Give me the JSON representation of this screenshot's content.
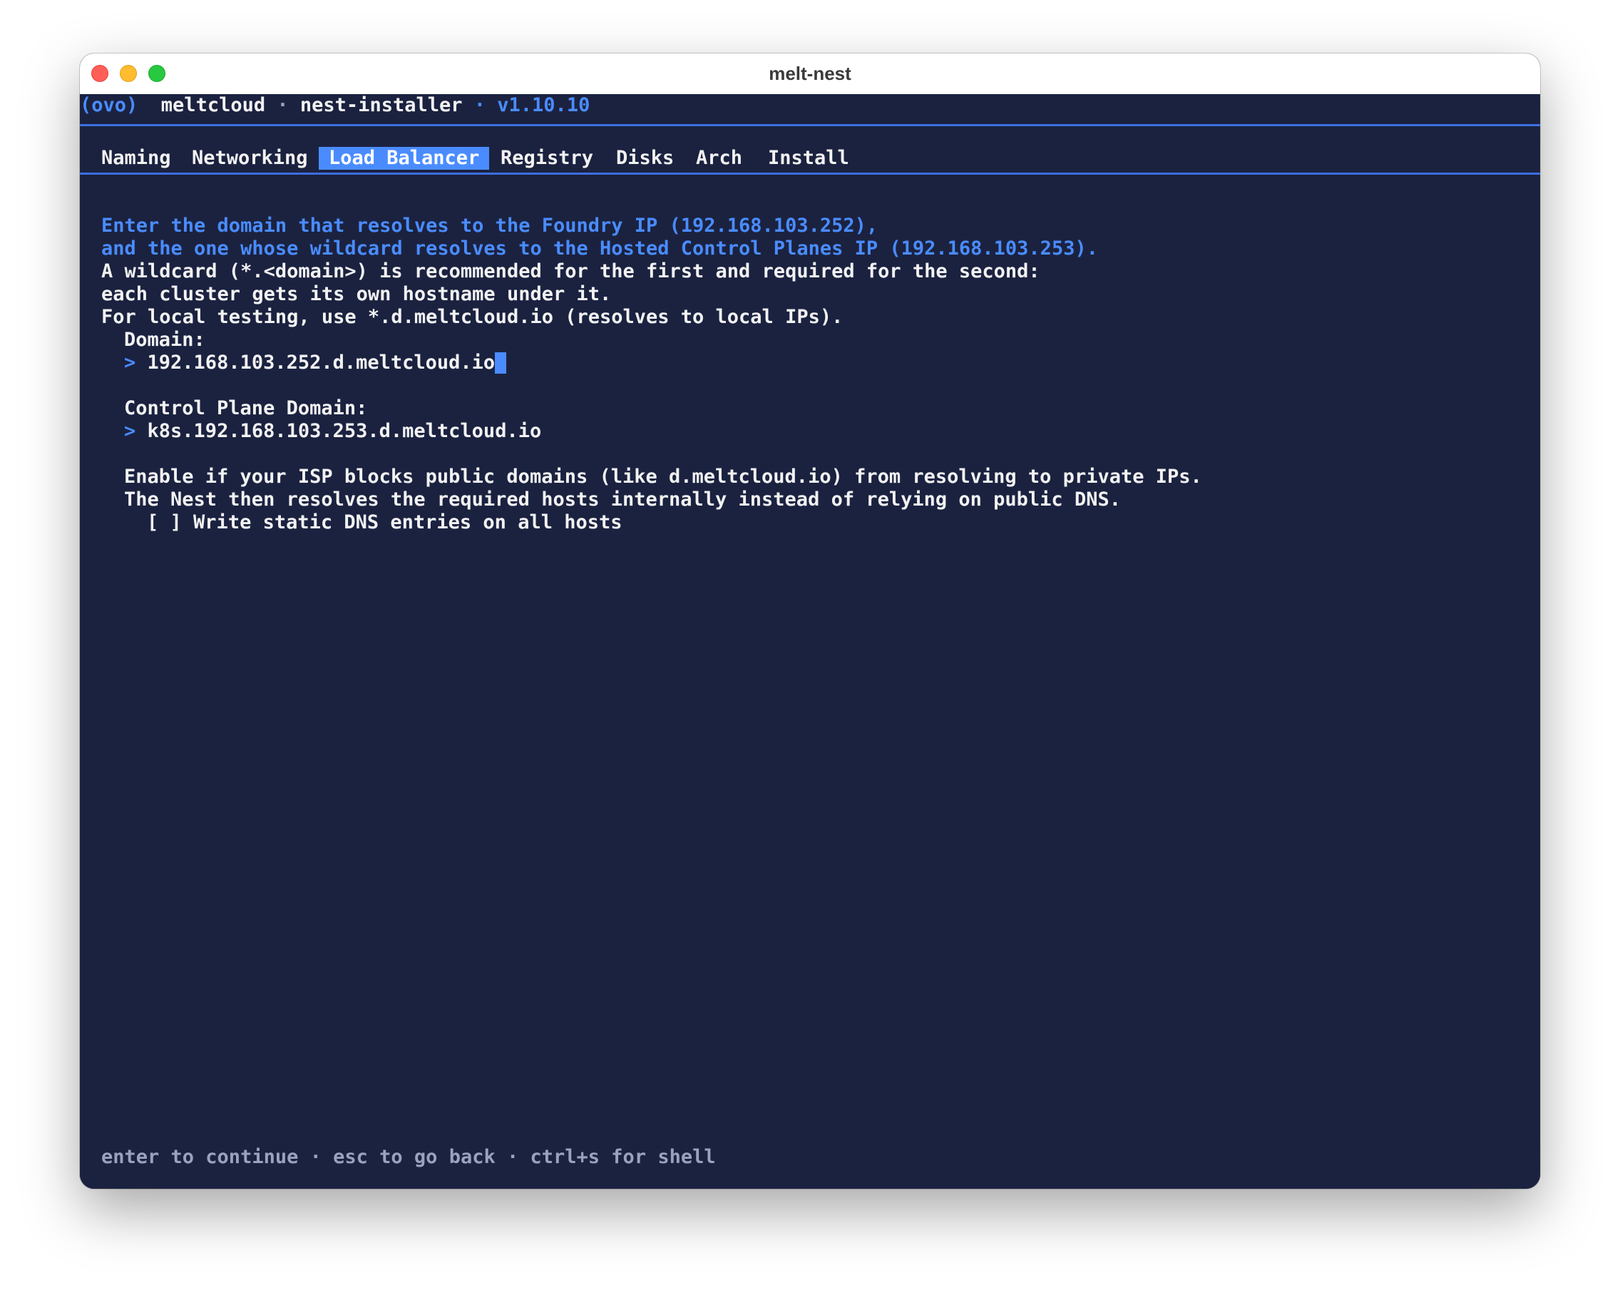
{
  "window": {
    "title": "melt-nest"
  },
  "header": {
    "logo": "(ovo)",
    "brand": "meltcloud",
    "separator": "·",
    "app": "nest-installer",
    "version": "v1.10.10"
  },
  "tabs": [
    {
      "label": "Naming",
      "active": false
    },
    {
      "label": "Networking",
      "active": false
    },
    {
      "label": "Load Balancer",
      "active": true
    },
    {
      "label": "Registry",
      "active": false
    },
    {
      "label": "Disks",
      "active": false
    },
    {
      "label": "Arch",
      "active": false
    },
    {
      "label": "Install",
      "active": false
    }
  ],
  "instructions": {
    "line1": "Enter the domain that resolves to the Foundry IP (192.168.103.252),",
    "line2": "and the one whose wildcard resolves to the Hosted Control Planes IP (192.168.103.253).",
    "line3": "A wildcard (*.<domain>) is recommended for the first and required for the second:",
    "line4": "each cluster gets its own hostname under it.",
    "line5": "For local testing, use *.d.meltcloud.io (resolves to local IPs)."
  },
  "domain": {
    "label": "Domain:",
    "prompt": ">",
    "value": "192.168.103.252.d.meltcloud.io"
  },
  "control_plane_domain": {
    "label": "Control Plane Domain:",
    "prompt": ">",
    "value": "k8s.192.168.103.253.d.meltcloud.io"
  },
  "dns": {
    "help1": "Enable if your ISP blocks public domains (like d.meltcloud.io) from resolving to private IPs.",
    "help2": "The Nest then resolves the required hosts internally instead of relying on public DNS.",
    "checkbox": "[ ]",
    "checkbox_label": "Write static DNS entries on all hosts",
    "checked": false
  },
  "footer": {
    "continue": "enter to continue",
    "back": "esc to go back",
    "shell": "ctrl+s for shell",
    "separator": "·"
  },
  "colors": {
    "background": "#1b2240",
    "accent": "#4a8cff",
    "text": "#f2f2f2",
    "muted": "#9aa2bd"
  }
}
